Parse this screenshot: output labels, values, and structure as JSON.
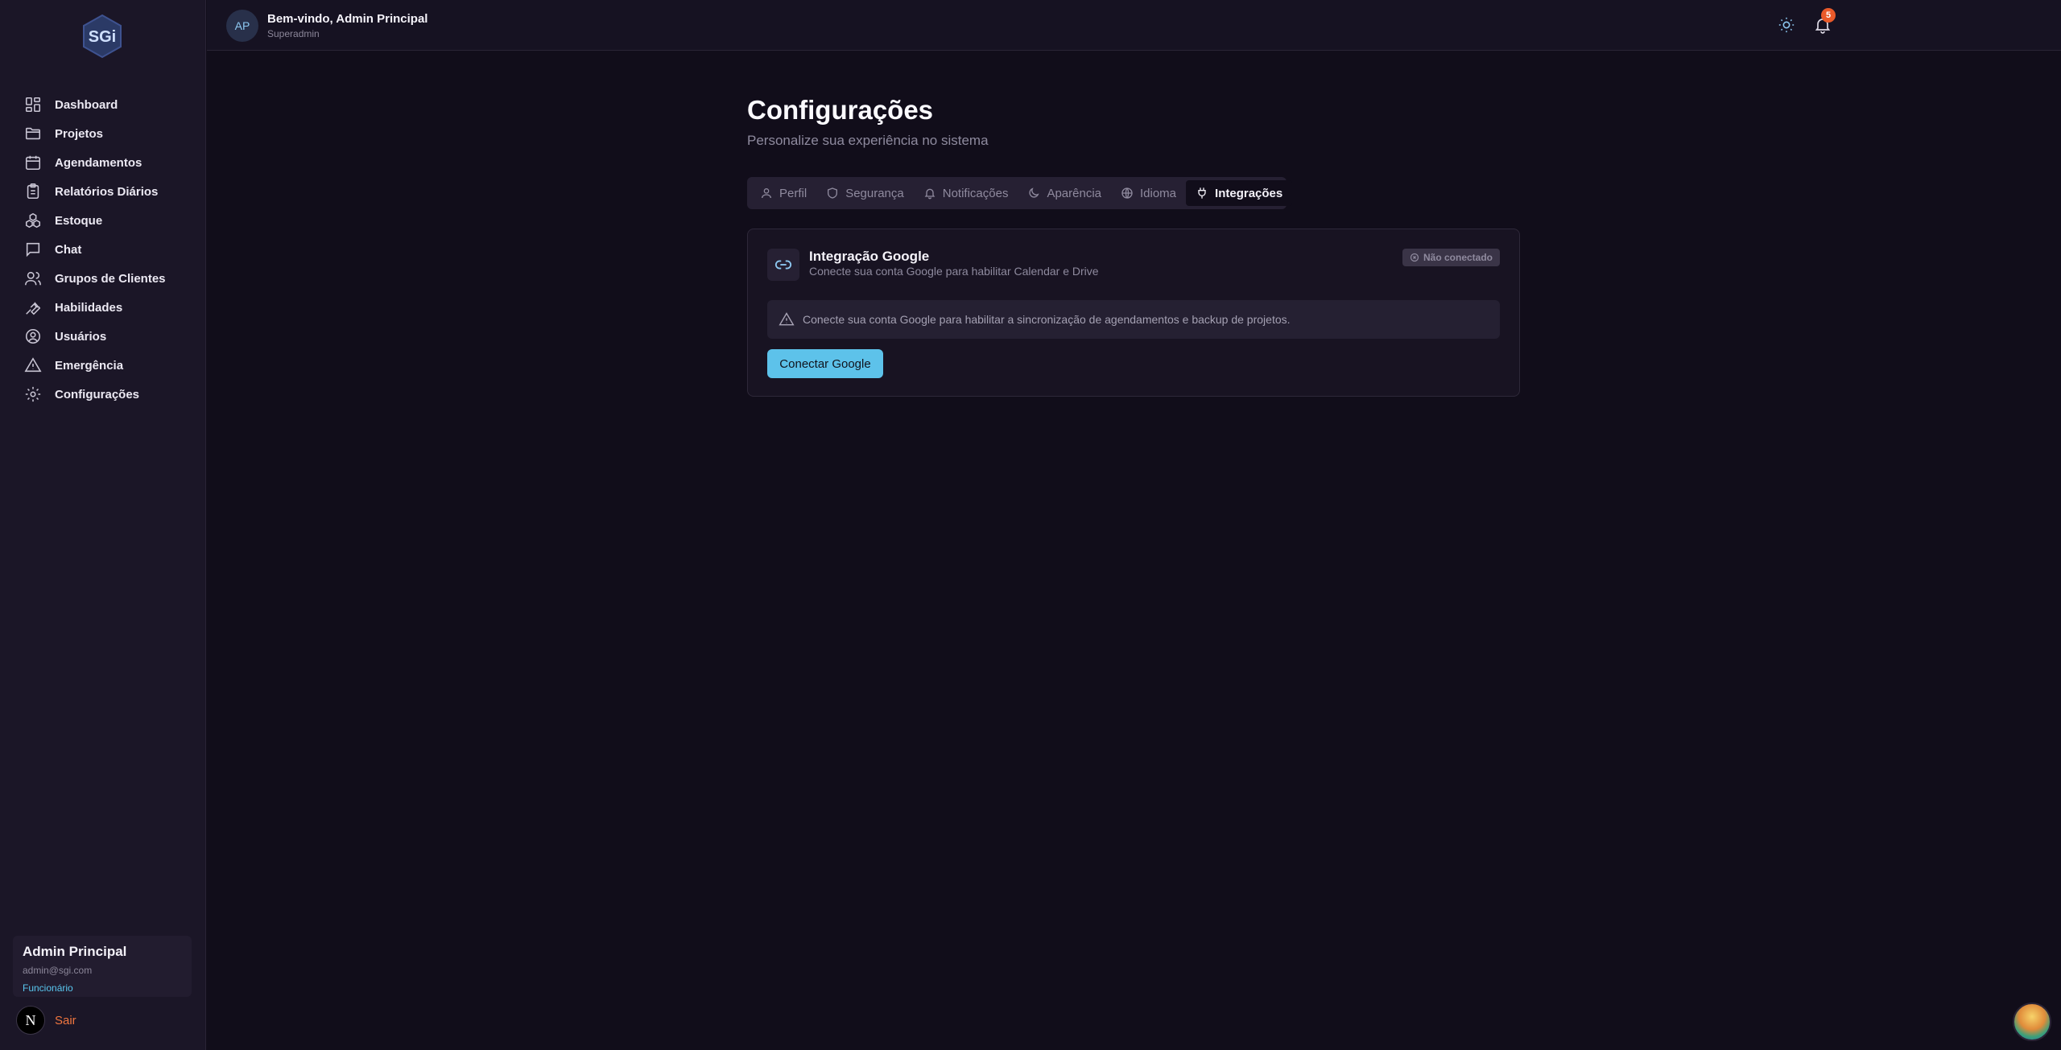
{
  "sidebar": {
    "logo_text": "SGi",
    "items": [
      {
        "label": "Dashboard",
        "icon": "layout-grid-icon"
      },
      {
        "label": "Projetos",
        "icon": "folder-icon"
      },
      {
        "label": "Agendamentos",
        "icon": "calendar-icon"
      },
      {
        "label": "Relatórios Diários",
        "icon": "clipboard-icon"
      },
      {
        "label": "Estoque",
        "icon": "boxes-icon"
      },
      {
        "label": "Chat",
        "icon": "message-square-icon"
      },
      {
        "label": "Grupos de Clientes",
        "icon": "users-icon"
      },
      {
        "label": "Habilidades",
        "icon": "wrench-icon"
      },
      {
        "label": "Usuários",
        "icon": "user-circle-icon"
      },
      {
        "label": "Emergência",
        "icon": "alert-triangle-icon"
      },
      {
        "label": "Configurações",
        "icon": "gear-icon"
      }
    ],
    "user": {
      "name": "Admin Principal",
      "email": "admin@sgi.com",
      "role": "Funcionário"
    },
    "badge_letter": "N",
    "logout_label": "Sair"
  },
  "header": {
    "avatar_initials": "AP",
    "welcome": "Bem-vindo, Admin Principal",
    "role": "Superadmin",
    "notifications_count": "5"
  },
  "main": {
    "title": "Configurações",
    "subtitle": "Personalize sua experiência no sistema",
    "tabs": [
      {
        "label": "Perfil",
        "icon": "user-icon"
      },
      {
        "label": "Segurança",
        "icon": "shield-icon"
      },
      {
        "label": "Notificações",
        "icon": "bell-icon"
      },
      {
        "label": "Aparência",
        "icon": "moon-icon"
      },
      {
        "label": "Idioma",
        "icon": "globe-icon"
      },
      {
        "label": "Integrações",
        "icon": "plug-icon",
        "active": true
      }
    ],
    "card": {
      "title": "Integração Google",
      "description": "Conecte sua conta Google para habilitar Calendar e Drive",
      "status": "Não conectado",
      "alert": "Conecte sua conta Google para habilitar a sincronização de agendamentos e backup de projetos.",
      "button": "Conectar Google"
    }
  },
  "colors": {
    "background": "#110d1a",
    "sidebar": "#1b1627",
    "accent": "#5dc2ea",
    "logout": "#f0763f",
    "notification_badge": "#ea5a2a"
  }
}
